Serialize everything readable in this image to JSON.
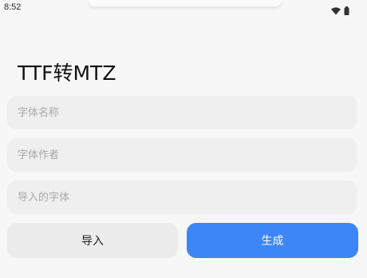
{
  "status_bar": {
    "time": "8:52",
    "icons": [
      "wifi-icon",
      "battery-icon"
    ]
  },
  "page": {
    "title": "TTF转MTZ"
  },
  "form": {
    "font_name_placeholder": "字体名称",
    "font_name_value": "",
    "font_author_placeholder": "字体作者",
    "font_author_value": "",
    "imported_font_placeholder": "导入的字体",
    "imported_font_value": ""
  },
  "actions": {
    "import_label": "导入",
    "generate_label": "生成"
  },
  "colors": {
    "background": "#f7f7f7",
    "field_background": "#efefef",
    "primary": "#3c86f7",
    "secondary_button": "#ececec"
  }
}
